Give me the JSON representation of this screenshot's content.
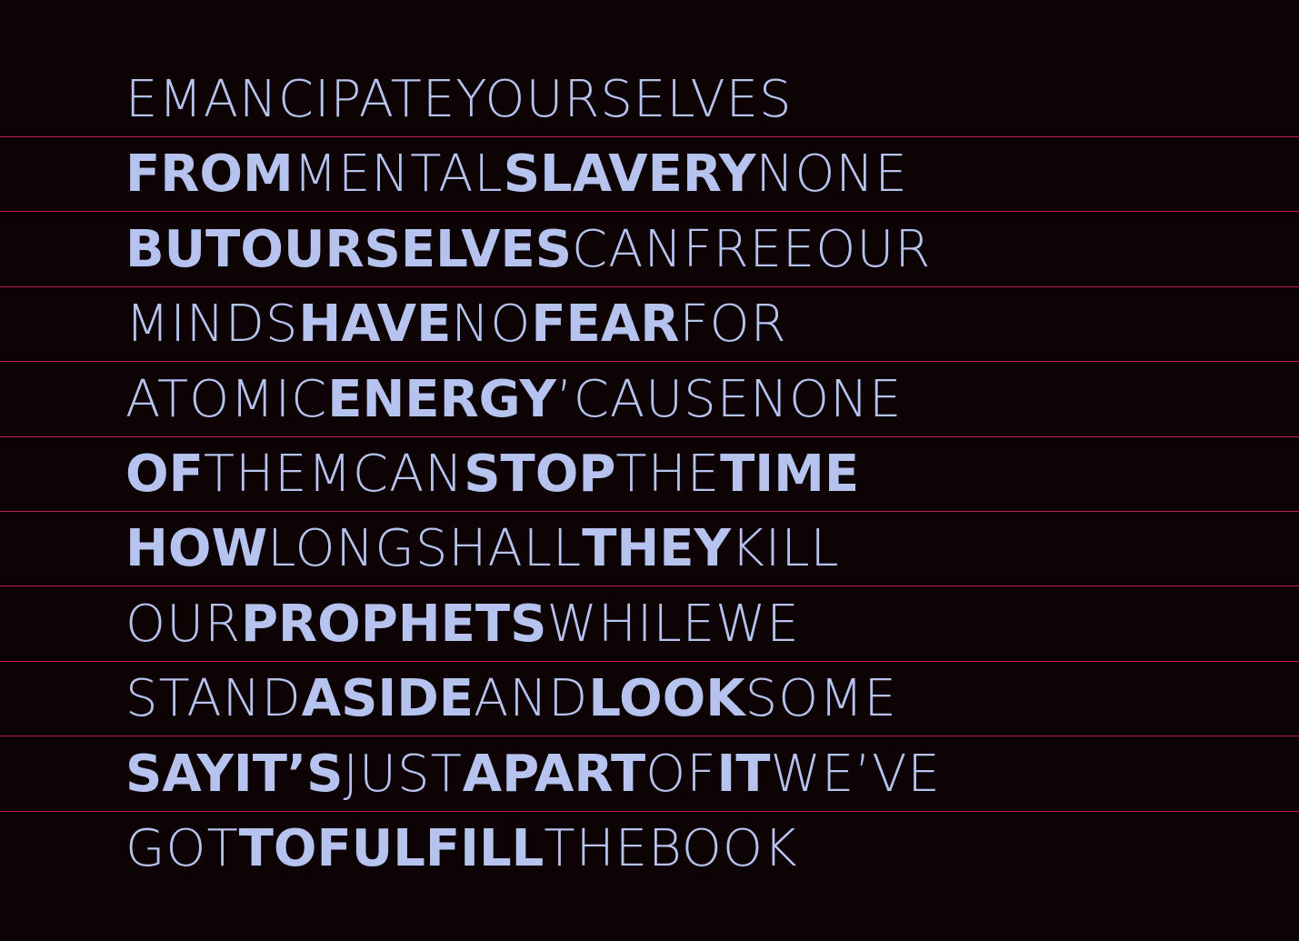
{
  "palette": {
    "background": "#0d0204",
    "text": "#b5c3ee",
    "rule": "#c2185b"
  },
  "lines": [
    [
      {
        "text": "Emancipate",
        "weight": "light"
      },
      {
        "text": "Yourselves",
        "weight": "light"
      }
    ],
    [
      {
        "text": "From",
        "weight": "bold"
      },
      {
        "text": "Mental",
        "weight": "light"
      },
      {
        "text": "Slavery",
        "weight": "bold"
      },
      {
        "text": "None",
        "weight": "light"
      }
    ],
    [
      {
        "text": "But",
        "weight": "bold"
      },
      {
        "text": "Ourselves",
        "weight": "bold"
      },
      {
        "text": "Can",
        "weight": "light"
      },
      {
        "text": "Free",
        "weight": "light"
      },
      {
        "text": "Our",
        "weight": "light"
      }
    ],
    [
      {
        "text": "Minds",
        "weight": "light"
      },
      {
        "text": "Have",
        "weight": "bold"
      },
      {
        "text": "No",
        "weight": "light"
      },
      {
        "text": "Fear",
        "weight": "bold"
      },
      {
        "text": "For",
        "weight": "light"
      }
    ],
    [
      {
        "text": "Atomic",
        "weight": "light"
      },
      {
        "text": "Energy",
        "weight": "bold"
      },
      {
        "text": "’Cause",
        "weight": "light"
      },
      {
        "text": "None",
        "weight": "light"
      }
    ],
    [
      {
        "text": "Of",
        "weight": "bold"
      },
      {
        "text": "Them",
        "weight": "light"
      },
      {
        "text": "Can",
        "weight": "light"
      },
      {
        "text": "Stop",
        "weight": "bold"
      },
      {
        "text": "The",
        "weight": "light"
      },
      {
        "text": "Time",
        "weight": "bold"
      }
    ],
    [
      {
        "text": "How",
        "weight": "bold"
      },
      {
        "text": "Long",
        "weight": "light"
      },
      {
        "text": "Shall",
        "weight": "light"
      },
      {
        "text": "They",
        "weight": "bold"
      },
      {
        "text": "Kill",
        "weight": "light"
      }
    ],
    [
      {
        "text": "Our",
        "weight": "light"
      },
      {
        "text": "Prophets",
        "weight": "bold"
      },
      {
        "text": "While",
        "weight": "light"
      },
      {
        "text": "We",
        "weight": "light"
      }
    ],
    [
      {
        "text": "Stand",
        "weight": "light"
      },
      {
        "text": "Aside",
        "weight": "bold"
      },
      {
        "text": "And",
        "weight": "light"
      },
      {
        "text": "Look",
        "weight": "bold"
      },
      {
        "text": "Some",
        "weight": "light"
      }
    ],
    [
      {
        "text": "Say",
        "weight": "bold"
      },
      {
        "text": "It’s",
        "weight": "bold"
      },
      {
        "text": "Just",
        "weight": "light"
      },
      {
        "text": "A",
        "weight": "bold"
      },
      {
        "text": "Part",
        "weight": "bold"
      },
      {
        "text": "Of",
        "weight": "light"
      },
      {
        "text": "It",
        "weight": "bold"
      },
      {
        "text": "We’ve",
        "weight": "light"
      }
    ],
    [
      {
        "text": "Got",
        "weight": "light"
      },
      {
        "text": "To",
        "weight": "bold"
      },
      {
        "text": "Fulfill",
        "weight": "bold"
      },
      {
        "text": "The",
        "weight": "light"
      },
      {
        "text": "Book",
        "weight": "light"
      }
    ]
  ]
}
